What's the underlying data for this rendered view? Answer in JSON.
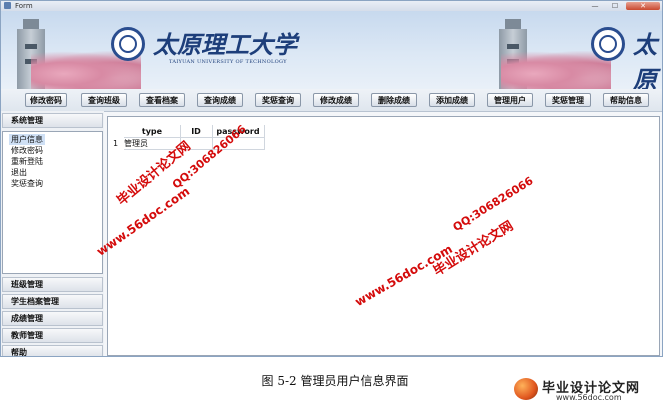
{
  "window": {
    "title": "Form",
    "controls": {
      "minimize": "—",
      "maximize": "☐",
      "close": "✕"
    }
  },
  "banner": {
    "university_name_cn": "太原理工大学",
    "university_name_en": "TAIYUAN UNIVERSITY OF TECHNOLOGY"
  },
  "toolbar": {
    "buttons": [
      "修改密码",
      "查询班级",
      "查看档案",
      "查询成绩",
      "奖惩查询",
      "修改成绩",
      "删除成绩",
      "添加成绩",
      "管理用户",
      "奖惩管理",
      "帮助信息"
    ]
  },
  "sidebar": {
    "system_header": "系统管理",
    "menu_items": [
      "用户信息",
      "修改密码",
      "重新登陆",
      "退出",
      "奖惩查询"
    ],
    "sections": [
      "班级管理",
      "学生档案管理",
      "成绩管理",
      "教师管理",
      "帮助"
    ]
  },
  "table": {
    "columns": [
      "type",
      "ID",
      "password"
    ],
    "rows": [
      {
        "number": "1",
        "type": "管理员",
        "id": "",
        "password": ""
      }
    ]
  },
  "watermarks": {
    "site_name": "毕业设计论文网",
    "url": "www.56doc.com",
    "qq": "QQ:306826066"
  },
  "caption": {
    "text": "图 5-2    管理员用户信息界面"
  },
  "logo": {
    "name": "毕业设计论文网",
    "url": "www.56doc.com"
  },
  "colors": {
    "watermark": "#d40b0b",
    "university_blue": "#1d3e7a",
    "selection": "#cfe0f5"
  }
}
